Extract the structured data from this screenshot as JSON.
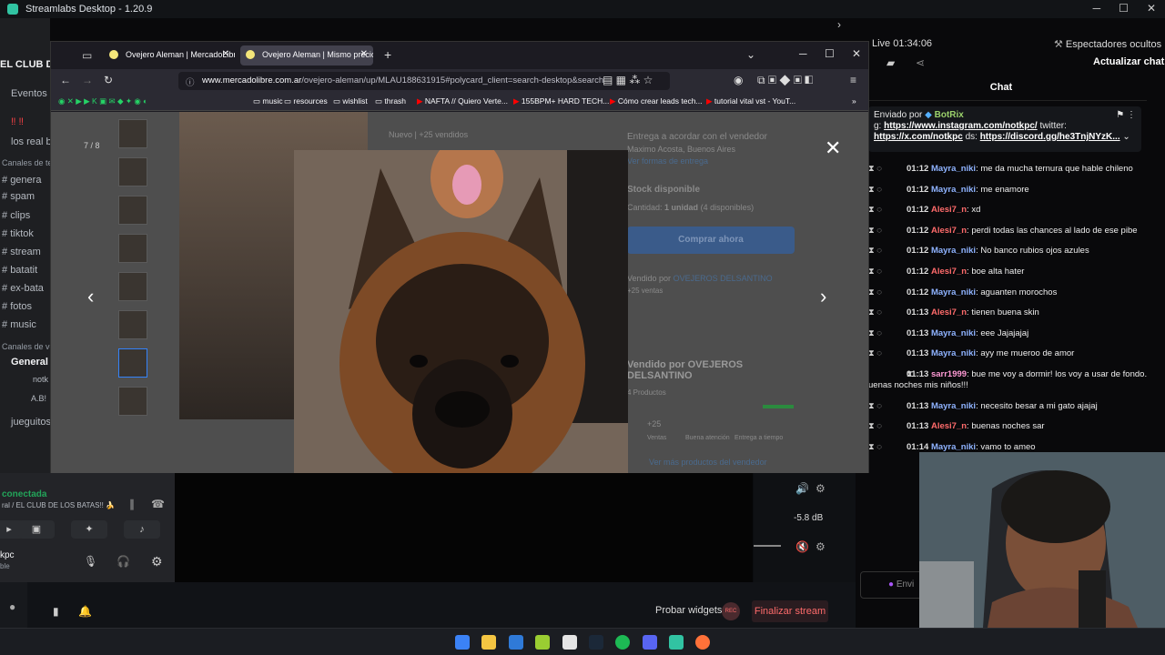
{
  "app": {
    "title": "Streamlabs Desktop - 1.20.9"
  },
  "discord": {
    "server_title": "EL CLUB DE",
    "items": [
      "Eventos",
      "‼ ‼",
      "los real b",
      "Canales de tex",
      "genera",
      "spam",
      "clips",
      "tiktok",
      "stream",
      "batatit",
      "ex-bata",
      "fotos",
      "music",
      "Canales de voz",
      "General",
      "notk",
      "A.B!",
      "jueguitos"
    ],
    "voice": {
      "status": "conectada",
      "channel": "ral / EL CLUB DE LOS BATAS!! 🍌"
    },
    "user": {
      "name": "kpc",
      "status": "ble"
    }
  },
  "browser": {
    "tabs": [
      {
        "label": "Ovejero Aleman | MercadoLibre"
      },
      {
        "label": "Ovejero Aleman | Mismo precio"
      }
    ],
    "url_host": "www.mercadolibre.com.ar",
    "url_path": "/ovejero-aleman/up/MLAU188631915#polycard_client=search-desktop&search",
    "bookmarks": [
      "music",
      "resources",
      "wishlist",
      "thrash",
      "NAFTA // Quiero Verte...",
      "155BPM+ HARD TECH...",
      "Cómo crear leads tech...",
      "tutorial vital vst - YouT..."
    ],
    "behind_tab": "EL CLUB DE LOS BATAS!! 🍌"
  },
  "gallery": {
    "counter": "7 / 8"
  },
  "listing": {
    "condition": "Nuevo",
    "sold": "+25 vendidos",
    "shipping_title": "Entrega a acordar con el vendedor",
    "location": "Maximo Acosta, Buenos Aires",
    "shipping_link": "Ver formas de entrega",
    "stock": "Stock disponible",
    "qty_label": "Cantidad:",
    "qty_value": "1 unidad",
    "qty_avail": "(4 disponibles)",
    "buy": "Comprar ahora",
    "sold_by_label": "Vendido por",
    "seller": "OVEJEROS DELSANTINO",
    "sales": "+25 ventas",
    "seller_title": "Vendido por OVEJEROS DELSANTINO",
    "products": "4 Productos",
    "metrics": [
      "+25",
      "Ventas",
      "Buena atención",
      "Entrega a tiempo"
    ],
    "more_link": "Ver más productos del vendedor"
  },
  "stream": {
    "live": "Live 01:34:06",
    "viewers_hidden": "Espectadores ocultos",
    "refresh_chat": "Actualizar chat",
    "chat_title": "Chat",
    "pinned_from": "Enviado por",
    "pinned_bot": "BotRix",
    "pinned_text1": "g: ",
    "pinned_link1": "https://www.instagram.com/notkpc/",
    "pinned_text2": " twitter:",
    "pinned_link2": "https://x.com/notkpc",
    "pinned_text3": " ds: ",
    "pinned_link3": "https://discord.gg/he3TnjNYzK...",
    "messages": [
      {
        "time": "01:12",
        "user": "Mayra_niki",
        "color": "#8fb3ff",
        "text": "me da mucha ternura que hable chileno"
      },
      {
        "time": "01:12",
        "user": "Mayra_niki",
        "color": "#8fb3ff",
        "text": "me enamore"
      },
      {
        "time": "01:12",
        "user": "Alesi7_n",
        "color": "#ff6b6b",
        "text": "xd"
      },
      {
        "time": "01:12",
        "user": "Alesi7_n",
        "color": "#ff6b6b",
        "text": "perdi todas las chances al lado de ese pibe"
      },
      {
        "time": "01:12",
        "user": "Mayra_niki",
        "color": "#8fb3ff",
        "text": "No banco rubios ojos azules"
      },
      {
        "time": "01:12",
        "user": "Alesi7_n",
        "color": "#ff6b6b",
        "text": "boe alta hater"
      },
      {
        "time": "01:12",
        "user": "Mayra_niki",
        "color": "#8fb3ff",
        "text": "aguanten morochos"
      },
      {
        "time": "01:13",
        "user": "Alesi7_n",
        "color": "#ff6b6b",
        "text": "tienen buena skin"
      },
      {
        "time": "01:13",
        "user": "Mayra_niki",
        "color": "#8fb3ff",
        "text": "eee Jajajajaj"
      },
      {
        "time": "01:13",
        "user": "Mayra_niki",
        "color": "#8fb3ff",
        "text": "ayy me mueroo de amor"
      },
      {
        "time": "01:13",
        "user": "sarr1999",
        "color": "#ff9ad5",
        "text": "bue me voy a dormir! los voy a usar de fondo. uenas noches mis niños!!!"
      },
      {
        "time": "01:13",
        "user": "Mayra_niki",
        "color": "#8fb3ff",
        "text": "necesito besar a mi gato ajajaj"
      },
      {
        "time": "01:13",
        "user": "Alesi7_n",
        "color": "#ff6b6b",
        "text": "buenas noches sar"
      },
      {
        "time": "01:14",
        "user": "Mayra_niki",
        "color": "#8fb3ff",
        "text": "vamo to ameo"
      }
    ],
    "input_placeholder": "Envi",
    "mixer_db": "-5.8 dB",
    "probar": "Probar widgets",
    "rec": "REC",
    "finalizar": "Finalizar stream"
  }
}
